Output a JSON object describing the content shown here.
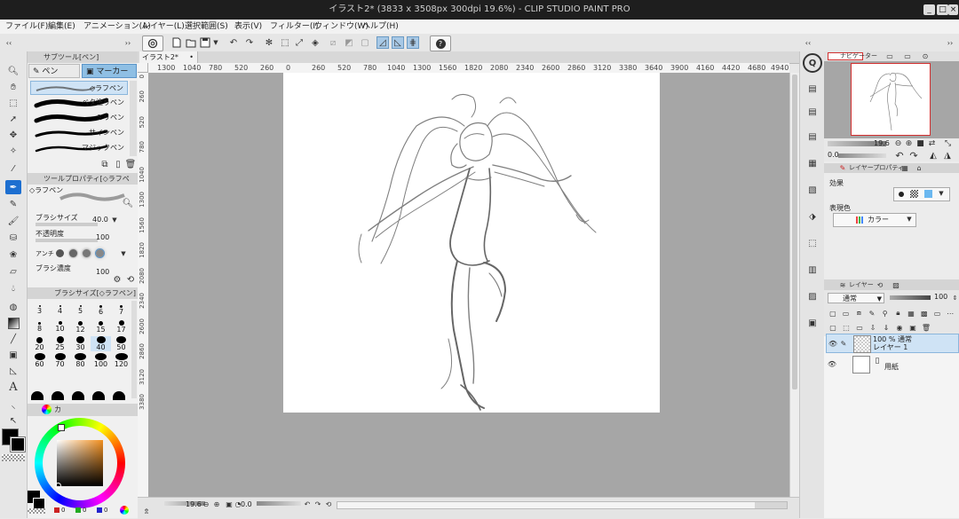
{
  "window": {
    "title": "イラスト2* (3833 x 3508px 300dpi 19.6%) - CLIP STUDIO PAINT PRO",
    "controls": [
      "_",
      "□",
      "×"
    ]
  },
  "menu": [
    {
      "label": "ファイル(F)"
    },
    {
      "label": "編集(E)"
    },
    {
      "label": "アニメーション(A)"
    },
    {
      "label": "レイヤー(L)"
    },
    {
      "label": "選択範囲(S)"
    },
    {
      "label": "表示(V)"
    },
    {
      "label": "フィルター(I)"
    },
    {
      "label": "ウィンドウ(W)"
    },
    {
      "label": "ヘルプ(H)"
    }
  ],
  "colors": {
    "accent_blue": "#1d6fd0",
    "tab_selected": "#8fbfe4",
    "canvas_bg": "#a6a6a6",
    "paper": "#ffffff",
    "title_bg": "#1e1e1e",
    "foreground_color": "#000000",
    "navigator_red": "#d23030"
  },
  "sub_tool": {
    "header": "サブツール[ペン]",
    "tabs": [
      {
        "label": "ペン",
        "selected": false
      },
      {
        "label": "マーカー",
        "selected": true
      }
    ],
    "brushes": [
      {
        "label": "◇ラフペン",
        "selected": true
      },
      {
        "label": "ベタ塗りペン",
        "selected": false
      },
      {
        "label": "ミリペン",
        "selected": false
      },
      {
        "label": "サインペン",
        "selected": false
      },
      {
        "label": "マジックペン",
        "selected": false
      }
    ]
  },
  "tool_property": {
    "header": "ツールプロパティ[◇ラフペン]",
    "tool_name": "◇ラフペン",
    "brush_size_label": "ブラシサイズ",
    "brush_size_value": "40.0",
    "opacity_label": "不透明度",
    "opacity_value": "100",
    "antialias_label": "アンチ",
    "density_label": "ブラシ濃度",
    "density_value": "100"
  },
  "brush_size_panel": {
    "header": "ブラシサイズ[◇ラフペン]",
    "sizes": [
      "3",
      "4",
      "5",
      "6",
      "7",
      "8",
      "10",
      "12",
      "15",
      "17",
      "20",
      "25",
      "30",
      "40",
      "50",
      "60",
      "70",
      "80",
      "100",
      "120"
    ],
    "selected": "40"
  },
  "color_panel": {
    "tab_label": "カ",
    "bottom_values": [
      "0",
      "0",
      "0"
    ]
  },
  "document": {
    "tab_label": "イラスト2*",
    "zoom": "19.6",
    "rotation": "0.0",
    "ruler_h": [
      "1300",
      "1040",
      "780",
      "520",
      "260",
      "0",
      "260",
      "520",
      "780",
      "1040",
      "1300",
      "1560",
      "1820",
      "2080",
      "2340",
      "2600",
      "2860",
      "3120",
      "3380",
      "3640",
      "3900",
      "4160",
      "4420",
      "4680",
      "4940"
    ],
    "ruler_v": [
      "0",
      "260",
      "520",
      "780",
      "1040",
      "1300",
      "1560",
      "1820",
      "2080",
      "2340",
      "2600",
      "2860",
      "3120",
      "3380"
    ]
  },
  "navigator": {
    "header": "ナビゲーター",
    "zoom": "19.6",
    "rotation": "0.0"
  },
  "layer_property": {
    "header": "レイヤープロパティ",
    "effect_label": "効果",
    "expression_label": "表現色",
    "expression_value": "カラー"
  },
  "layer_panel": {
    "header": "レイヤー",
    "blend_mode": "通常",
    "opacity": "100",
    "layers": [
      {
        "line1": "100 % 通常",
        "line2": "レイヤー 1",
        "selected": true
      },
      {
        "line1": "",
        "line2": "用紙",
        "selected": false
      }
    ]
  },
  "icons": {
    "tools": [
      "zoom-icon",
      "move-icon",
      "lasso-select-icon",
      "operation-icon",
      "move-layer-icon",
      "auto-select-icon",
      "eyedropper-icon",
      "pen-icon",
      "pencil-icon",
      "brush-icon",
      "airbrush-icon",
      "decoration-icon",
      "eraser-icon",
      "blend-icon",
      "fill-icon",
      "gradient-icon",
      "figure-icon",
      "frame-icon",
      "ruler-icon",
      "text-icon",
      "balloon-icon",
      "correct-line-icon"
    ]
  }
}
